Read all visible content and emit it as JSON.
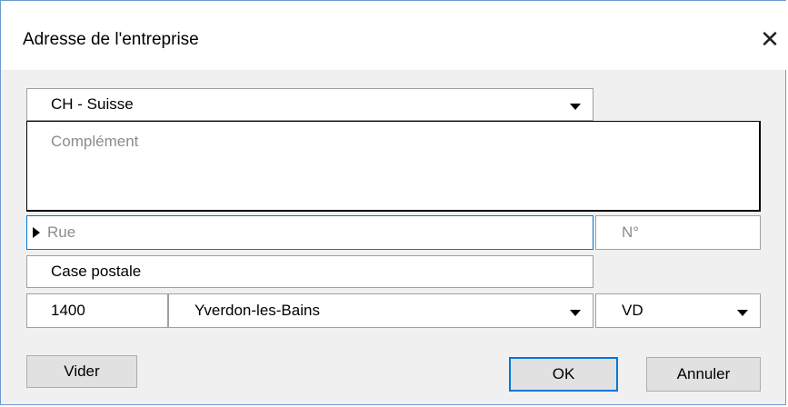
{
  "dialog": {
    "title": "Adresse de l'entreprise",
    "close_glyph": "✕"
  },
  "form": {
    "country": {
      "value": "CH - Suisse"
    },
    "complement": {
      "placeholder": "Complément"
    },
    "street": {
      "placeholder": "Rue"
    },
    "number": {
      "placeholder": "N°"
    },
    "po_box": {
      "value": "Case postale"
    },
    "zip": {
      "value": "1400"
    },
    "city": {
      "value": "Yverdon-les-Bains"
    },
    "canton": {
      "value": "VD"
    }
  },
  "buttons": {
    "clear": "Vider",
    "ok": "OK",
    "cancel": "Annuler"
  },
  "colors": {
    "focus_border": "#0078d7"
  }
}
